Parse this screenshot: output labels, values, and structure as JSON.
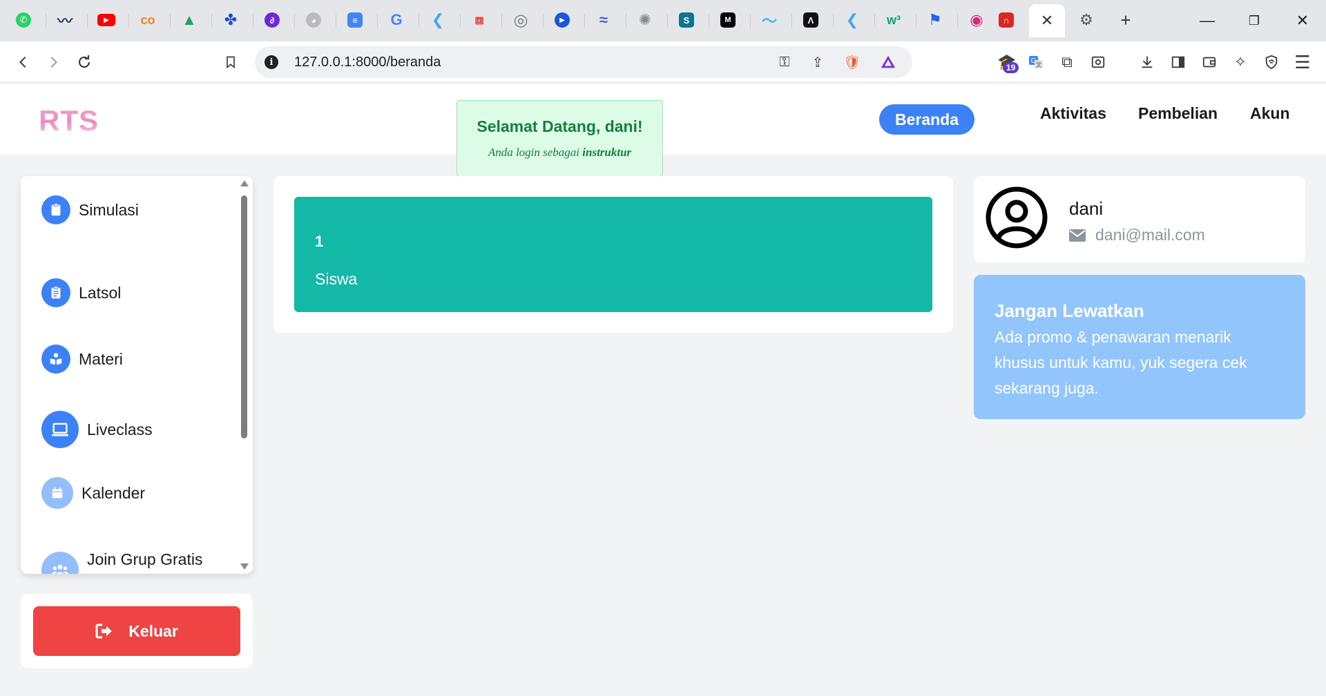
{
  "browser": {
    "tab_icons": [
      "whatsapp-icon",
      "tab-flutter-swift-icon",
      "youtube-icon",
      "coursera-icon",
      "google-drive-icon",
      "tab-bluesky-icon",
      "tab-purple-icon",
      "github-icon",
      "google-forms-icon",
      "google-icon",
      "flutter-icon",
      "laravel-icon",
      "tab-circle-icon",
      "tab-play-icon",
      "tab-docker-icon",
      "openai-icon",
      "tab-s-icon",
      "medium-icon",
      "tailwind-icon",
      "tab-a-icon",
      "flutter-icon-2",
      "w3schools-icon",
      "tab-flag-icon",
      "tab-pink-icon",
      "tab-red-icon"
    ],
    "active_tab_close": "✕",
    "url": "127.0.0.1:8000/beranda",
    "extension_badge": "19"
  },
  "navbar": {
    "logo": "RTS",
    "links": {
      "beranda": "Beranda",
      "aktivitas": "Aktivitas",
      "pembelian": "Pembelian",
      "akun": "Akun"
    }
  },
  "toast": {
    "title": "Selamat Datang, dani!",
    "subtitle_prefix": "Anda login sebagai ",
    "role": "instruktur"
  },
  "sidebar": {
    "items": [
      {
        "label": "Simulasi",
        "icon": "clipboard-icon"
      },
      {
        "label": "Latsol",
        "icon": "clipboard-list-icon"
      },
      {
        "label": "Materi",
        "icon": "book-reader-icon"
      },
      {
        "label": "Liveclass",
        "icon": "laptop-icon"
      },
      {
        "label": "Kalender",
        "icon": "calendar-icon"
      },
      {
        "label": "Join Grup Gratis",
        "icon": "users-icon"
      }
    ],
    "logout_label": "Keluar"
  },
  "main": {
    "stat_value": "1",
    "stat_label": "Siswa",
    "stat_color": "#14b8a6"
  },
  "profile": {
    "name": "dani",
    "email": "dani@mail.com"
  },
  "promo": {
    "title": "Jangan Lewatkan",
    "text": "Ada promo & penawaran menarik khusus untuk kamu, yuk segera cek sekarang juga."
  },
  "colors": {
    "primary": "#3c82f6",
    "danger": "#ef4444",
    "promo_bg": "#93c5fd",
    "toast_bg": "#dcfce7",
    "toast_text": "#15803d"
  }
}
